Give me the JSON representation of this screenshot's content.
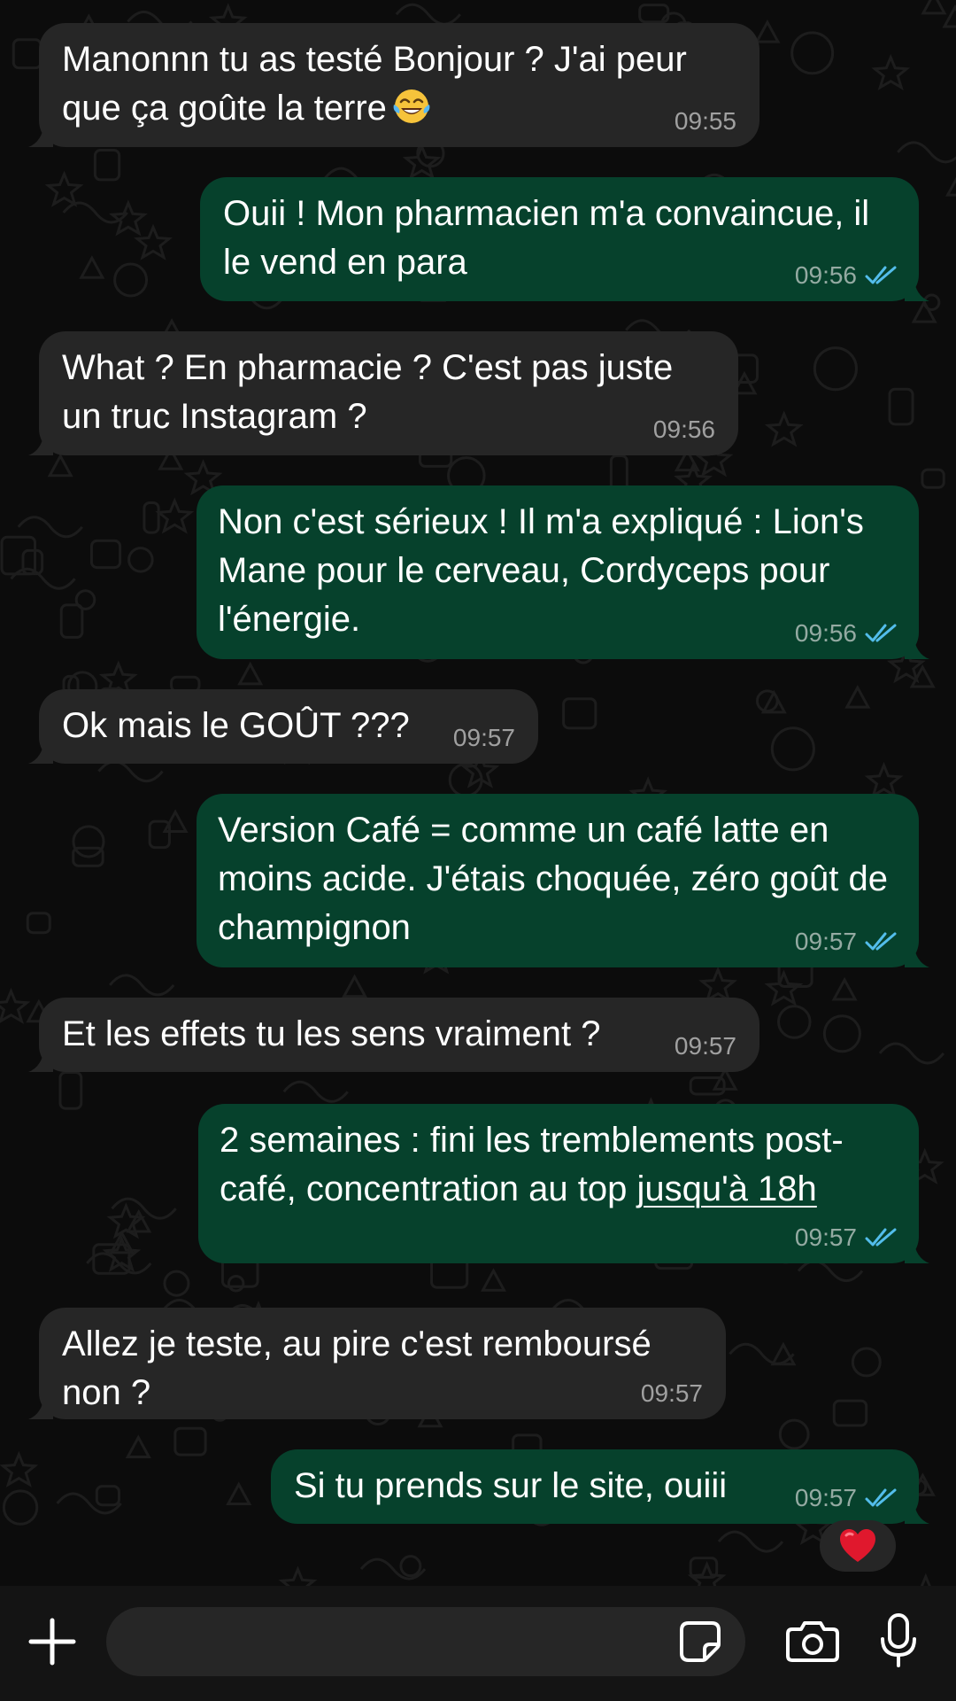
{
  "colors": {
    "incoming_bubble": "#262626",
    "outgoing_bubble": "#06412c",
    "read_ticks": "#53bdeb",
    "background": "#0c0c0c"
  },
  "messages": [
    {
      "direction": "in",
      "text": "Manonnn tu as testé Bonjour ? J'ai peur que ça goûte la terre",
      "emoji": "face-with-tears-of-joy",
      "time": "09:55"
    },
    {
      "direction": "out",
      "text": "Ouii ! Mon pharmacien m'a convaincue, il le vend en para",
      "time": "09:56",
      "status": "read"
    },
    {
      "direction": "in",
      "text": "What ? En pharmacie ? C'est pas juste un truc Instagram ?",
      "time": "09:56"
    },
    {
      "direction": "out",
      "text": "Non c'est sérieux ! Il m'a expliqué : Lion's Mane pour le cerveau, Cordyceps pour l'énergie.",
      "time": "09:56",
      "status": "read"
    },
    {
      "direction": "in",
      "text": "Ok mais le GOÛT ???",
      "time": "09:57"
    },
    {
      "direction": "out",
      "text": "Version Café = comme un café latte en moins acide. J'étais choquée, zéro goût de champignon",
      "time": "09:57",
      "status": "read"
    },
    {
      "direction": "in",
      "text": "Et les effets tu les sens vraiment ?",
      "time": "09:57"
    },
    {
      "direction": "out",
      "text": "2 semaines : fini les tremblements post-café, concentration au top ",
      "link_text": "jusqu'à 18h",
      "time": "09:57",
      "status": "read"
    },
    {
      "direction": "in",
      "text": "Allez je teste, au pire c'est remboursé non ?",
      "time": "09:57"
    },
    {
      "direction": "out",
      "text": "Si tu prends sur le site, ouiii",
      "time": "09:57",
      "status": "read",
      "reaction": "heart-emoji"
    }
  ],
  "composer": {
    "input_value": "",
    "icons": [
      "plus-icon",
      "sticker-icon",
      "camera-icon",
      "microphone-icon"
    ]
  }
}
